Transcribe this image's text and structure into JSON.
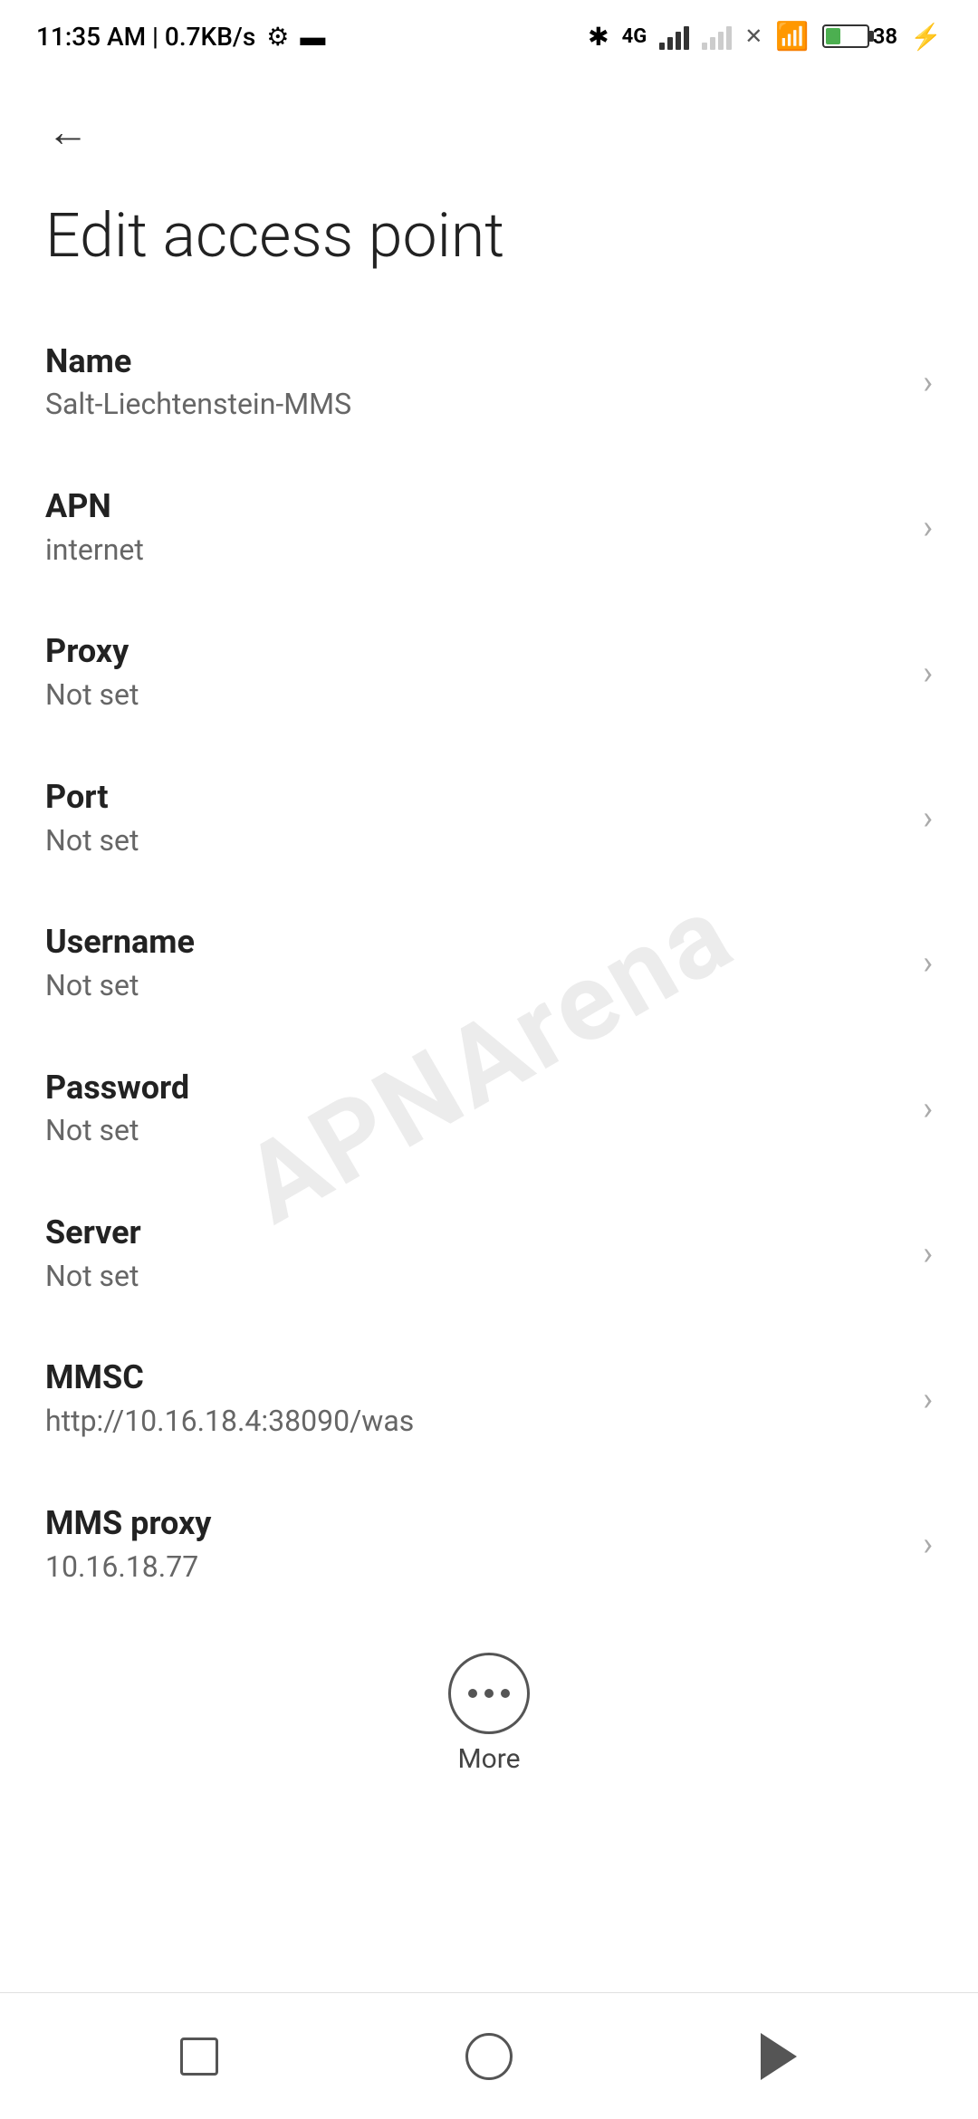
{
  "statusBar": {
    "time": "11:35 AM | 0.7KB/s",
    "settingsIcon": "gear-icon",
    "videoIcon": "video-icon",
    "bluetoothIcon": "bluetooth-icon",
    "networkType": "4G",
    "batteryPercent": "38",
    "charging": true
  },
  "header": {
    "backLabel": "←",
    "title": "Edit access point"
  },
  "settings": {
    "items": [
      {
        "label": "Name",
        "value": "Salt-Liechtenstein-MMS"
      },
      {
        "label": "APN",
        "value": "internet"
      },
      {
        "label": "Proxy",
        "value": "Not set"
      },
      {
        "label": "Port",
        "value": "Not set"
      },
      {
        "label": "Username",
        "value": "Not set"
      },
      {
        "label": "Password",
        "value": "Not set"
      },
      {
        "label": "Server",
        "value": "Not set"
      },
      {
        "label": "MMSC",
        "value": "http://10.16.18.4:38090/was"
      },
      {
        "label": "MMS proxy",
        "value": "10.16.18.77"
      }
    ]
  },
  "more": {
    "label": "More"
  },
  "navbar": {
    "square": "recent-apps-icon",
    "circle": "home-icon",
    "triangle": "back-icon"
  },
  "watermark": "APNArena"
}
